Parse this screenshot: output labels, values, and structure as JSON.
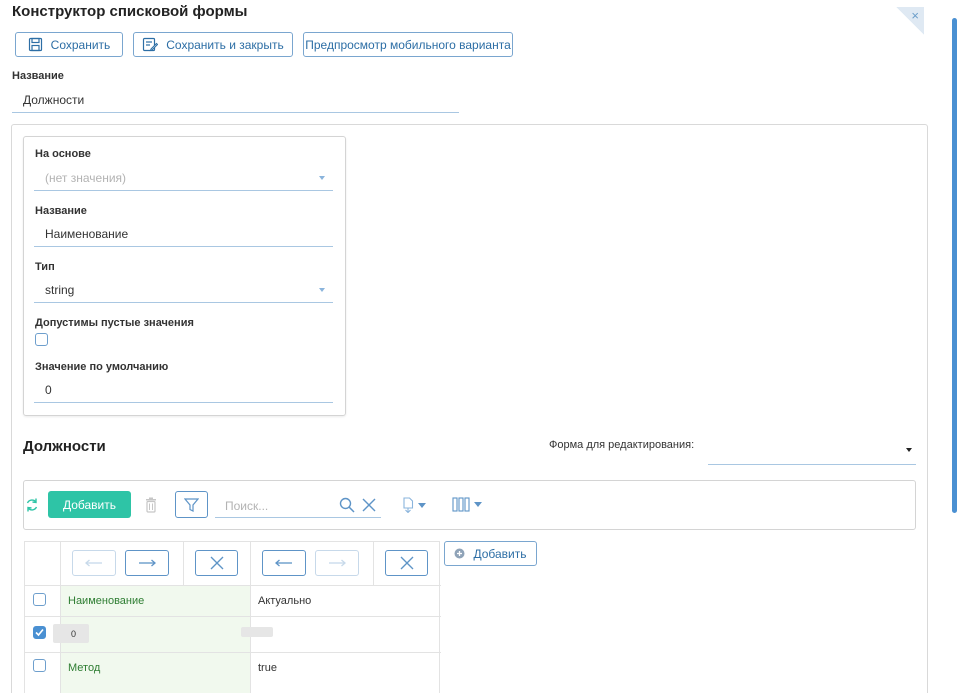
{
  "header": {
    "title": "Конструктор списковой формы",
    "close_symbol": "×"
  },
  "actions": {
    "save_label": "Сохранить",
    "save_close_label": "Сохранить и закрыть",
    "preview_label": "Предпросмотр мобильного варианта"
  },
  "form": {
    "name_label": "Название",
    "name_value": "Должности"
  },
  "column_card": {
    "based_on_label": "На основе",
    "based_on_value": "(нет значения)",
    "name_label": "Название",
    "name_value": "Наименование",
    "type_label": "Тип",
    "type_value": "string",
    "allow_empty_label": "Допустимы пустые значения",
    "allow_empty_checked": false,
    "default_label": "Значение по умолчанию",
    "default_value": "0"
  },
  "section": {
    "title": "Должности",
    "edit_form_label": "Форма для редактирования:",
    "edit_form_value": ""
  },
  "toolbar": {
    "add_label": "Добавить",
    "search_placeholder": "Поиск..."
  },
  "grid": {
    "add_column_label": "Добавить",
    "columns": [
      "Наименование",
      "Актуально"
    ],
    "rows": [
      {
        "checked": false,
        "cells": [
          "Наименование",
          "Актуально"
        ]
      },
      {
        "checked": true,
        "cells": [
          "0",
          ""
        ]
      },
      {
        "checked": false,
        "cells": [
          "Метод",
          "true"
        ]
      }
    ]
  },
  "colors": {
    "accent": "#2ec4a6",
    "link": "#2d6ea5",
    "border": "#7aa6cf",
    "green_cell": "#f1f9ee",
    "green_text": "#2e7d32"
  }
}
